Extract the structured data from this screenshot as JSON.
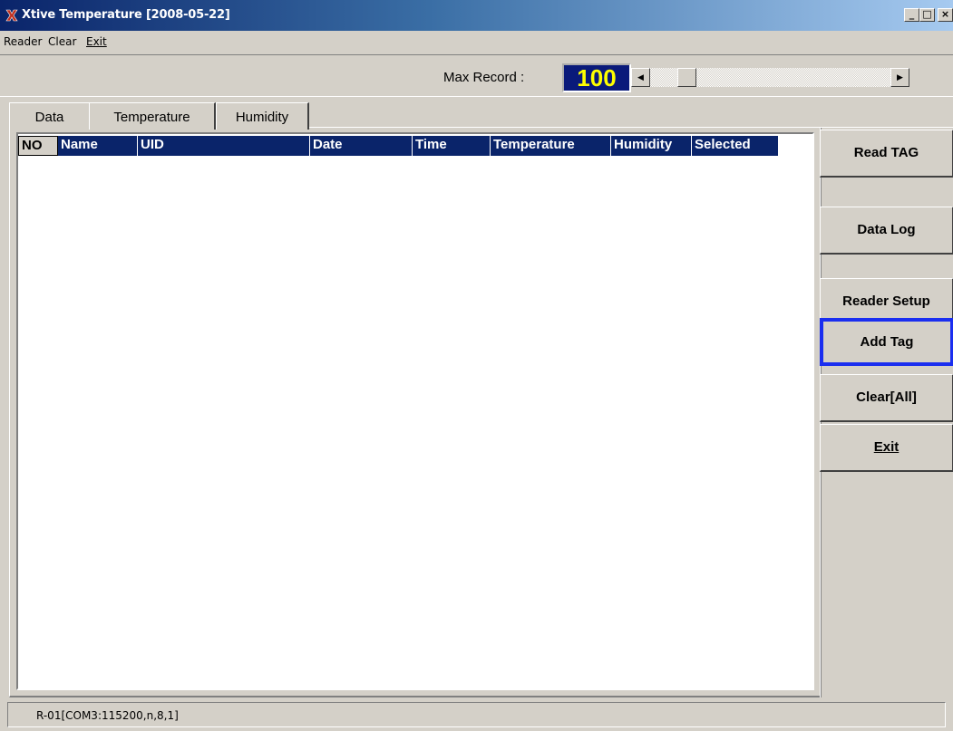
{
  "window": {
    "title": "Xtive Temperature [2008-05-22]",
    "controls": {
      "minimize": "_",
      "maximize": "□",
      "close": "×"
    }
  },
  "menu": {
    "items": [
      {
        "label": "Reader"
      },
      {
        "label": "Clear"
      },
      {
        "label": "Exit",
        "underline_first": true
      }
    ]
  },
  "toolbar": {
    "max_record_label": "Max Record :",
    "max_record_value": "100"
  },
  "tabs": [
    {
      "label": "Data",
      "selected": true
    },
    {
      "label": "Temperature",
      "selected": false
    },
    {
      "label": "Humidity",
      "selected": false
    }
  ],
  "table": {
    "columns": [
      "NO",
      "Name",
      "UID",
      "Date",
      "Time",
      "Temperature",
      "Humidity",
      "Selected"
    ],
    "rows": []
  },
  "side_buttons": [
    {
      "label": "Read TAG"
    },
    {
      "label": "Data Log"
    },
    {
      "label": "Reader Setup"
    },
    {
      "label": "Add Tag",
      "focused": true
    },
    {
      "label": "Clear[All]"
    },
    {
      "label": "Exit"
    }
  ],
  "status": {
    "text": "R-01[COM3:115200,n,8,1]"
  },
  "colors": {
    "title_start": "#0a246a",
    "header_bg": "#0a246a",
    "max_value_fg": "#ffff00",
    "focus_border": "#1a2ef0"
  },
  "icons": {
    "app": "x-logo-icon",
    "scroll_left": "arrow-left-icon",
    "scroll_right": "arrow-right-icon"
  }
}
